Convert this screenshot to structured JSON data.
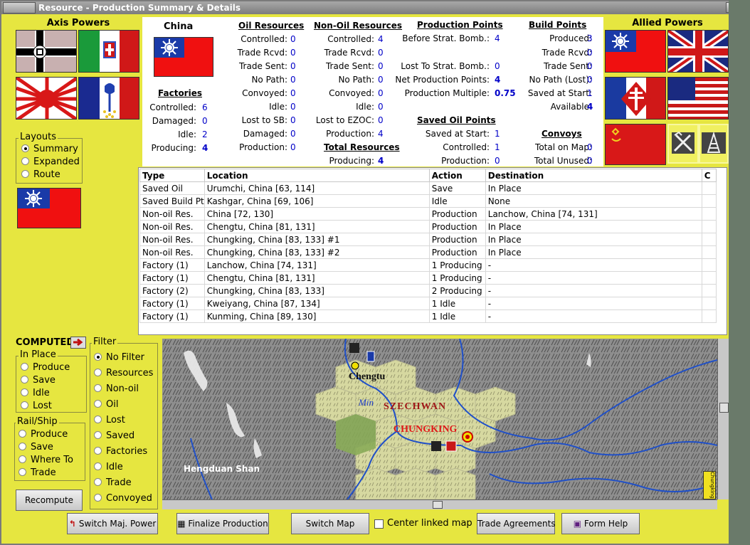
{
  "window": {
    "title": "Resource - Production Summary & Details",
    "close": "×"
  },
  "axis": {
    "title": "Axis Powers"
  },
  "allied": {
    "title": "Allied Powers"
  },
  "country": {
    "name": "China"
  },
  "factories": {
    "header": "Factories",
    "controlled_l": "Controlled:",
    "controlled": "6",
    "damaged_l": "Damaged:",
    "damaged": "0",
    "idle_l": "Idle:",
    "idle": "2",
    "producing_l": "Producing:",
    "producing": "4"
  },
  "oil": {
    "header": "Oil Resources",
    "controlled_l": "Controlled:",
    "controlled": "0",
    "trade_rcvd_l": "Trade Rcvd:",
    "trade_rcvd": "0",
    "trade_sent_l": "Trade Sent:",
    "trade_sent": "0",
    "no_path_l": "No Path:",
    "no_path": "0",
    "convoyed_l": "Convoyed:",
    "convoyed": "0",
    "idle_l": "Idle:",
    "idle": "0",
    "lost_sb_l": "Lost to SB:",
    "lost_sb": "0",
    "damaged_l": "Damaged:",
    "damaged": "0",
    "production_l": "Production:",
    "production": "0"
  },
  "nonoil": {
    "header": "Non-Oil Resources",
    "controlled_l": "Controlled:",
    "controlled": "4",
    "trade_rcvd_l": "Trade Rcvd:",
    "trade_rcvd": "0",
    "trade_sent_l": "Trade Sent:",
    "trade_sent": "0",
    "no_path_l": "No Path:",
    "no_path": "0",
    "convoyed_l": "Convoyed:",
    "convoyed": "0",
    "idle_l": "Idle:",
    "idle": "0",
    "lost_ezoc_l": "Lost to EZOC:",
    "lost_ezoc": "0",
    "production_l": "Production:",
    "production": "4"
  },
  "total": {
    "header": "Total Resources",
    "producing_l": "Producing:",
    "producing": "4"
  },
  "pp": {
    "header": "Production Points",
    "before_l": "Before Strat. Bomb.:",
    "before": "4",
    "lost_l": "Lost To Strat. Bomb.:",
    "lost": "0",
    "net_l": "Net Production Points:",
    "net": "4",
    "mult_l": "Production Multiple:",
    "mult": "0.75"
  },
  "sop": {
    "header": "Saved Oil Points",
    "saved_l": "Saved at Start:",
    "saved": "1",
    "controlled_l": "Controlled:",
    "controlled": "1",
    "production_l": "Production:",
    "production": "0"
  },
  "bp": {
    "header": "Build Points",
    "produced_l": "Produced:",
    "produced": "3",
    "trade_rcvd_l": "Trade Rcvd:",
    "trade_rcvd": "0",
    "trade_sent_l": "Trade Sent:",
    "trade_sent": "0",
    "nopath_l": "No Path (Lost):",
    "nopath": "0",
    "saved_l": "Saved at Start:",
    "saved": "1",
    "avail_l": "Available:",
    "avail": "4"
  },
  "convoys": {
    "header": "Convoys",
    "onmap_l": "Total on Map:",
    "onmap": "0",
    "unused_l": "Total Unused:",
    "unused": "0"
  },
  "layouts": {
    "title": "Layouts",
    "items": [
      "Summary",
      "Expanded",
      "Route"
    ],
    "selected": 0
  },
  "table": {
    "columns": [
      "Type",
      "Location",
      "Action",
      "Destination",
      "C"
    ],
    "rows": [
      [
        "Saved Oil",
        "Urumchi, China [63, 114]",
        "Save",
        "In Place",
        ""
      ],
      [
        "Saved Build Pt",
        "Kashgar, China [69, 106]",
        "Idle",
        "None",
        ""
      ],
      [
        "Non-oil Res.",
        "China [72, 130]",
        "Production",
        "Lanchow, China [74, 131]",
        ""
      ],
      [
        "Non-oil Res.",
        "Chengtu, China [81, 131]",
        "Production",
        "In Place",
        ""
      ],
      [
        "Non-oil Res.",
        "Chungking, China [83, 133] #1",
        "Production",
        "In Place",
        ""
      ],
      [
        "Non-oil Res.",
        "Chungking, China [83, 133] #2",
        "Production",
        "In Place",
        ""
      ],
      [
        "Factory (1)",
        "Lanchow, China [74, 131]",
        "1 Producing",
        "-",
        ""
      ],
      [
        "Factory (1)",
        "Chengtu, China [81, 131]",
        "1 Producing",
        "-",
        ""
      ],
      [
        "Factory (2)",
        "Chungking, China [83, 133]",
        "2 Producing",
        "-",
        ""
      ],
      [
        "Factory (1)",
        "Kweiyang, China [87, 134]",
        "1 Idle",
        "-",
        ""
      ],
      [
        "Factory (1)",
        "Kunming, China [89, 130]",
        "1 Idle",
        "-",
        ""
      ]
    ]
  },
  "computed": {
    "label": "COMPUTED"
  },
  "inplace": {
    "title": "In Place",
    "items": [
      "Produce",
      "Save",
      "Idle",
      "Lost"
    ]
  },
  "railship": {
    "title": "Rail/Ship",
    "items": [
      "Produce",
      "Save",
      "Where To",
      "Trade"
    ]
  },
  "filter": {
    "title": "Filter",
    "items": [
      "No Filter",
      "Resources",
      "Non-oil",
      "Oil",
      "Lost",
      "Saved",
      "Factories",
      "Idle",
      "Trade",
      "Convoyed"
    ],
    "selected": 0
  },
  "map": {
    "chengtu": "Chengtu",
    "min": "Min",
    "szechwan": "SZECHWAN",
    "chungking": "CHUNGKING",
    "hengduan": "Hengduan Shan",
    "tab": "Chungking"
  },
  "buttons": {
    "recompute": "Recompute",
    "switch_major": "Switch Maj. Power",
    "finalize": "Finalize Production",
    "switch_map": "Switch Map",
    "center_linked": "Center linked map",
    "trade": "Trade Agreements",
    "help": "Form Help"
  }
}
